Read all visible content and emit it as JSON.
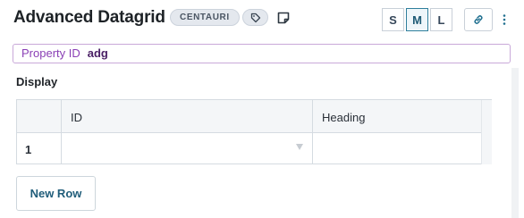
{
  "header": {
    "title": "Advanced Datagrid",
    "badge": "CENTAURI",
    "icons": {
      "tag": "tag-icon",
      "note": "note-icon",
      "link": "link-icon",
      "more": "kebab-icon"
    }
  },
  "sizes": [
    {
      "label": "S",
      "active": false
    },
    {
      "label": "M",
      "active": true
    },
    {
      "label": "L",
      "active": false
    }
  ],
  "property": {
    "label": "Property ID",
    "value": "adg"
  },
  "display": {
    "label": "Display",
    "columns": [
      "ID",
      "Heading"
    ],
    "rows": [
      {
        "index": "1",
        "id": "",
        "heading": ""
      }
    ]
  },
  "actions": {
    "new_row": "New Row"
  },
  "colors": {
    "accent": "#2f7f9c",
    "property_label": "#8a3fb5",
    "property_value": "#4b2166"
  }
}
